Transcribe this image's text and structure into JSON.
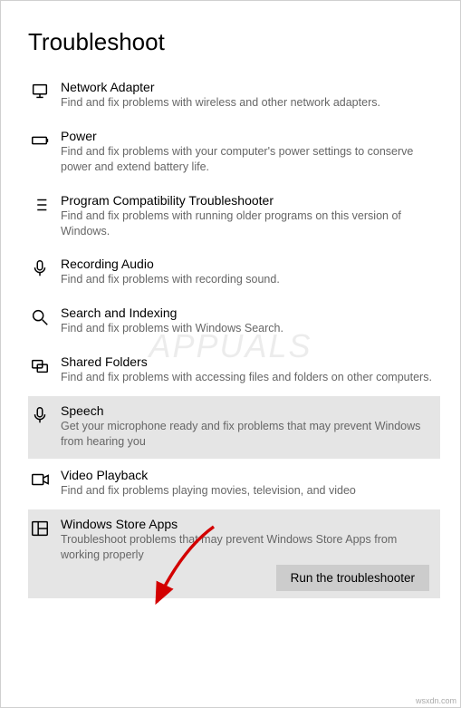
{
  "page_title": "Troubleshoot",
  "items": [
    {
      "title": "Network Adapter",
      "desc": "Find and fix problems with wireless and other network adapters.",
      "selected": false
    },
    {
      "title": "Power",
      "desc": "Find and fix problems with your computer's power settings to conserve power and extend battery life.",
      "selected": false
    },
    {
      "title": "Program Compatibility Troubleshooter",
      "desc": "Find and fix problems with running older programs on this version of Windows.",
      "selected": false
    },
    {
      "title": "Recording Audio",
      "desc": "Find and fix problems with recording sound.",
      "selected": false
    },
    {
      "title": "Search and Indexing",
      "desc": "Find and fix problems with Windows Search.",
      "selected": false
    },
    {
      "title": "Shared Folders",
      "desc": "Find and fix problems with accessing files and folders on other computers.",
      "selected": false
    },
    {
      "title": "Speech",
      "desc": "Get your microphone ready and fix problems that may prevent Windows from hearing you",
      "selected": true
    },
    {
      "title": "Video Playback",
      "desc": "Find and fix problems playing movies, television, and video",
      "selected": false
    },
    {
      "title": "Windows Store Apps",
      "desc": "Troubleshoot problems that may prevent Windows Store Apps from working properly",
      "selected": false,
      "active": true
    }
  ],
  "run_button": "Run the troubleshooter",
  "watermark": "APPUALS",
  "footer": "wsxdn.com"
}
